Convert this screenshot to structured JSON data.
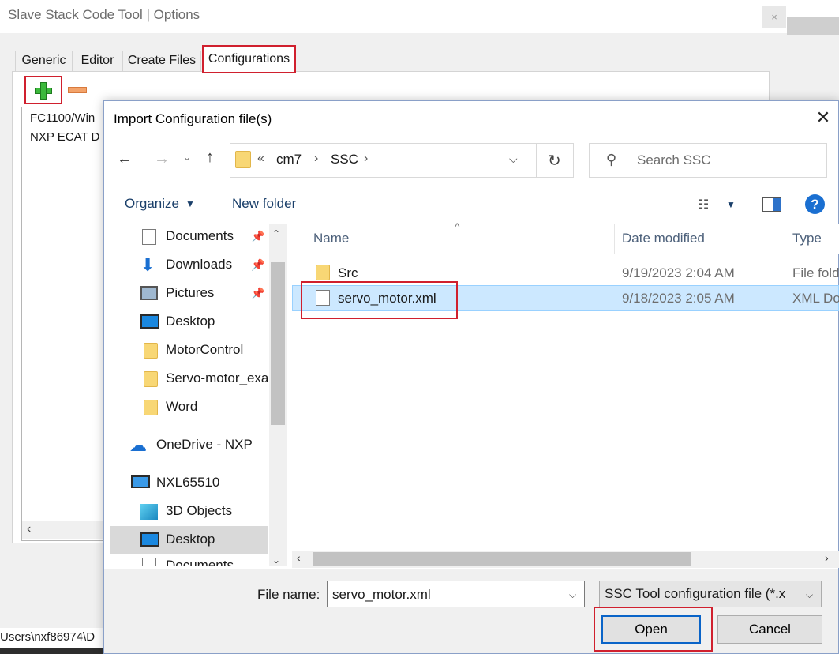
{
  "background_window": {
    "title": "Slave Stack Code Tool | Options",
    "close_glyph": "×",
    "tabs": [
      "Generic",
      "Editor",
      "Create Files",
      "Configurations"
    ],
    "active_tab": "Configurations",
    "config_list": [
      "FC1100/Win",
      "NXP ECAT D"
    ],
    "status_text": "Users\\nxf86974\\D"
  },
  "dialog": {
    "title": "Import Configuration file(s)",
    "close_glyph": "✕",
    "address": {
      "overflow": "«",
      "crumbs": [
        "cm7",
        "SSC"
      ],
      "separator": "›"
    },
    "search_placeholder": "Search SSC",
    "toolbar": {
      "organize": "Organize",
      "new_folder": "New folder",
      "help": "?"
    },
    "nav_items": [
      {
        "label": "Documents",
        "icon": "documents-icon",
        "pinned": true
      },
      {
        "label": "Downloads",
        "icon": "downloads-icon",
        "pinned": true
      },
      {
        "label": "Pictures",
        "icon": "pictures-icon",
        "pinned": true
      },
      {
        "label": "Desktop",
        "icon": "desktop-icon",
        "pinned": false
      },
      {
        "label": "MotorControl",
        "icon": "folder-icon",
        "pinned": false
      },
      {
        "label": "Servo-motor_exa",
        "icon": "folder-icon",
        "pinned": false
      },
      {
        "label": "Word",
        "icon": "folder-icon",
        "pinned": false
      },
      {
        "label": "OneDrive - NXP",
        "icon": "onedrive-icon",
        "pinned": false
      },
      {
        "label": "NXL65510",
        "icon": "computer-icon",
        "pinned": false
      },
      {
        "label": "3D Objects",
        "icon": "3d-objects-icon",
        "pinned": false
      },
      {
        "label": "Desktop",
        "icon": "desktop-icon",
        "pinned": false,
        "selected": true
      },
      {
        "label": "Documents",
        "icon": "documents-icon",
        "pinned": false
      }
    ],
    "columns": [
      "Name",
      "Date modified",
      "Type"
    ],
    "files": [
      {
        "name": "Src",
        "date": "9/19/2023 2:04 AM",
        "type": "File fold",
        "icon": "folder-icon"
      },
      {
        "name": "servo_motor.xml",
        "date": "9/18/2023 2:05 AM",
        "type": "XML Do",
        "icon": "file-icon",
        "selected": true
      }
    ],
    "file_name_label": "File name:",
    "file_name_value": "servo_motor.xml",
    "file_type_value": "SSC Tool configuration file (*.x",
    "open_label": "Open",
    "cancel_label": "Cancel"
  },
  "colors": {
    "highlight_red": "#d0202e",
    "selection_blue": "#cce8ff",
    "accent_blue": "#0a64c8"
  }
}
